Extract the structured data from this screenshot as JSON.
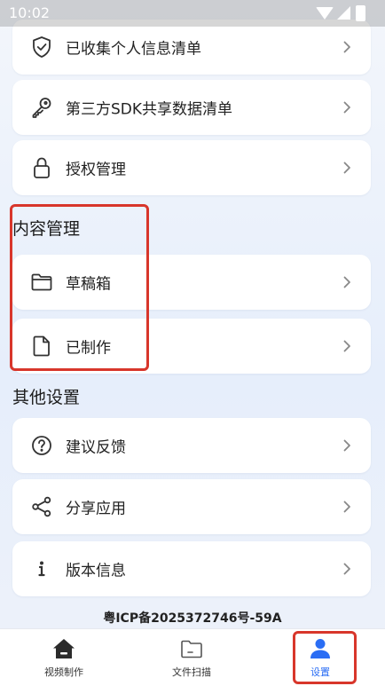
{
  "status_bar": {
    "time": "10:02"
  },
  "privacy_cards": [
    {
      "label": "已收集个人信息清单",
      "icon": "shield-check-icon"
    },
    {
      "label": "第三方SDK共享数据清单",
      "icon": "key-icon"
    },
    {
      "label": "授权管理",
      "icon": "lock-icon"
    }
  ],
  "content_section": {
    "title": "内容管理",
    "items": [
      {
        "label": "草稿箱",
        "icon": "folder-icon"
      },
      {
        "label": "已制作",
        "icon": "document-icon"
      }
    ]
  },
  "other_section": {
    "title": "其他设置",
    "items": [
      {
        "label": "建议反馈",
        "icon": "question-circle-icon"
      },
      {
        "label": "分享应用",
        "icon": "share-icon"
      },
      {
        "label": "版本信息",
        "icon": "info-icon"
      }
    ]
  },
  "footer": {
    "icp": "粤ICP备2025372746号-59A"
  },
  "bottom_nav": {
    "items": [
      {
        "label": "视频制作",
        "icon": "home-icon"
      },
      {
        "label": "文件扫描",
        "icon": "folder-scan-icon"
      },
      {
        "label": "设置",
        "icon": "user-icon",
        "active": true
      }
    ],
    "active_color": "#2a6df4"
  },
  "colors": {
    "highlight_border": "#d8362b",
    "accent": "#2a6df4",
    "card_bg": "#ffffff"
  }
}
